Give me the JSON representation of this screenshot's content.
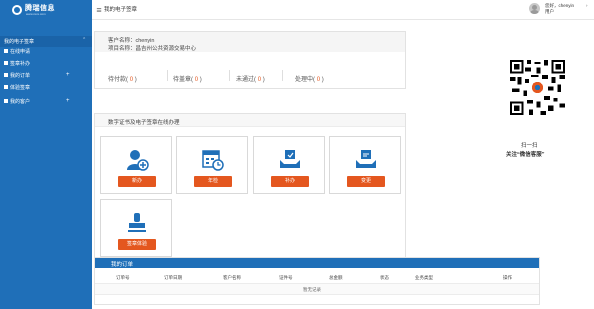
{
  "brand": {
    "name": "腾瑞信息",
    "sub": "www.xxxx.com"
  },
  "header": {
    "page_tab": "我的电子签章",
    "user_greeting": "您好，chenyin",
    "user_role": "用户",
    "user_caret": "›"
  },
  "sidebar": {
    "section_label": "我的电子签章",
    "items": [
      {
        "label": "在线申请",
        "has_plus": false
      },
      {
        "label": "签章补办",
        "has_plus": false
      },
      {
        "label": "我的订单",
        "has_plus": true
      },
      {
        "label": "体验签章",
        "has_plus": false
      },
      {
        "label": "我的客户",
        "has_plus": true
      }
    ]
  },
  "info": {
    "customer_name": "客户名称：chenyin",
    "project_name": "项目名称：昌吉州公共资源交易中心",
    "stats": [
      {
        "label": "待付款",
        "value": "0"
      },
      {
        "label": "待盖章",
        "value": "0"
      },
      {
        "label": "未通过",
        "value": "0"
      },
      {
        "label": "处理中",
        "value": "0"
      }
    ]
  },
  "services": {
    "title": "数字证书及电子签章在线办理",
    "cards": [
      {
        "label": "新办",
        "icon": "new-user-icon"
      },
      {
        "label": "年检",
        "icon": "calendar-check-icon"
      },
      {
        "label": "补办",
        "icon": "reissue-box-icon"
      },
      {
        "label": "变更",
        "icon": "change-box-icon"
      },
      {
        "label": "签章体验",
        "icon": "stamp-icon"
      }
    ]
  },
  "qr": {
    "caption_line1": "扫一扫",
    "caption_line2": "关注“微信客服”"
  },
  "orders": {
    "title": "我的订单",
    "columns": [
      "订单号",
      "订单日期",
      "客户名称",
      "证件号",
      "总金额",
      "状态",
      "业务类型",
      "操作"
    ],
    "empty_text": "暂无记录"
  },
  "colors": {
    "brand_blue": "#1f6fb8",
    "accent_orange": "#e4571f"
  }
}
